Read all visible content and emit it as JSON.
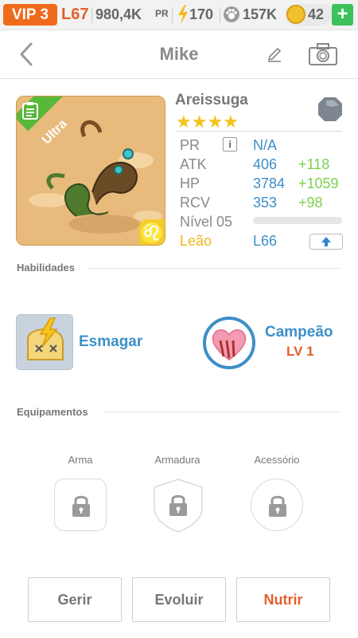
{
  "statusbar": {
    "vip": "VIP 3",
    "level": "L67",
    "power": "980,4K",
    "power_unit": "PR",
    "energy": "170",
    "paws": "157K",
    "coins": "42",
    "add": "+"
  },
  "nav": {
    "title": "Mike"
  },
  "monster": {
    "name": "Areissuga",
    "rarity": "Ultra",
    "stars": "★★★★",
    "star_count": 4,
    "zodiac_symbol": "♌",
    "stats": {
      "pr_label": "PR",
      "pr_value": "N/A",
      "atk_label": "ATK",
      "atk_value": "406",
      "atk_bonus": "+118",
      "hp_label": "HP",
      "hp_value": "3784",
      "hp_bonus": "+1059",
      "rcv_label": "RCV",
      "rcv_value": "353",
      "rcv_bonus": "+98",
      "level_label": "Nível 05",
      "level_progress": 0.0,
      "sign_label": "Leão",
      "sign_level": "L66"
    }
  },
  "skills": {
    "title": "Habilidades",
    "items": [
      {
        "name": "Esmagar"
      },
      {
        "name": "Campeão",
        "level": "LV 1"
      }
    ]
  },
  "equipment": {
    "title": "Equipamentos",
    "slots": [
      "Arma",
      "Armadura",
      "Acessório"
    ]
  },
  "actions": {
    "manage": "Gerir",
    "evolve": "Evoluir",
    "feed": "Nutrir"
  },
  "colors": {
    "accent_orange": "#e2602a",
    "value_blue": "#3d8fc8",
    "bonus_green": "#7ad04f",
    "star_gold": "#f6c21a",
    "ultra_green": "#58b83a"
  }
}
